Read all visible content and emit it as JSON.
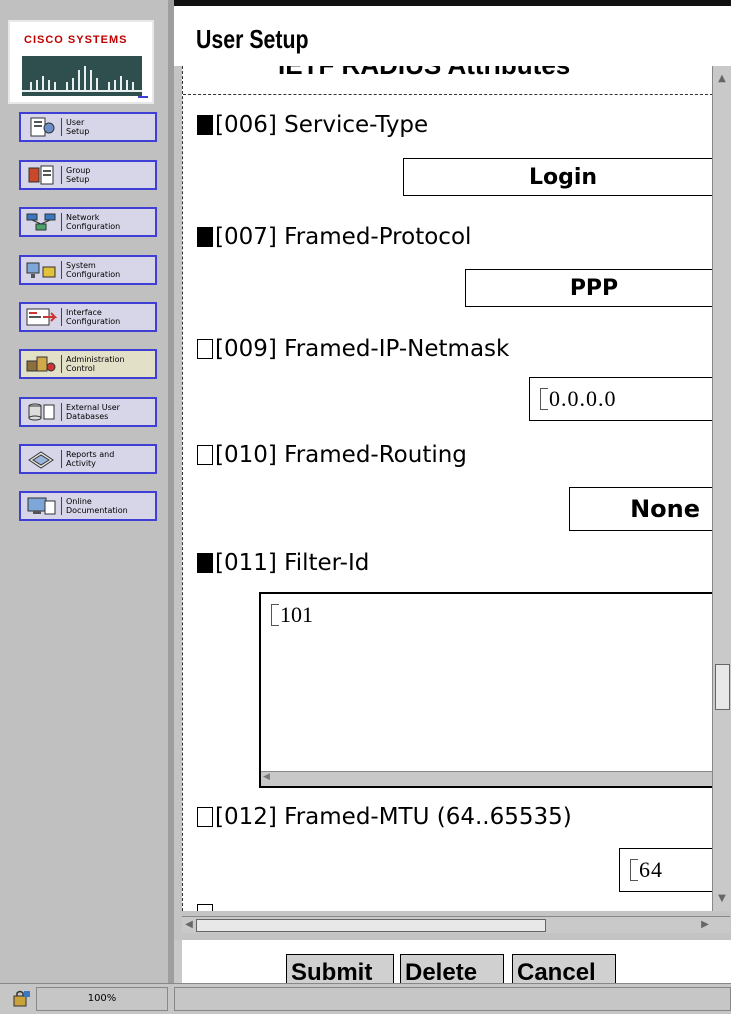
{
  "brand": {
    "logo_text": "Cisco Systems"
  },
  "nav": {
    "items": [
      {
        "label": "User\nSetup",
        "icon": "user-setup-icon"
      },
      {
        "label": "Group\nSetup",
        "icon": "group-setup-icon"
      },
      {
        "label": "Network\nConfiguration",
        "icon": "network-configuration-icon"
      },
      {
        "label": "System\nConfiguration",
        "icon": "system-configuration-icon"
      },
      {
        "label": "Interface\nConfiguration",
        "icon": "interface-configuration-icon"
      },
      {
        "label": "Administration\nControl",
        "icon": "administration-control-icon"
      },
      {
        "label": "External User\nDatabases",
        "icon": "external-user-databases-icon"
      },
      {
        "label": "Reports and\nActivity",
        "icon": "reports-activity-icon"
      },
      {
        "label": "Online\nDocumentation",
        "icon": "online-documentation-icon"
      }
    ]
  },
  "page": {
    "title": "User Setup"
  },
  "section": {
    "heading": "IETF RADIUS Attributes"
  },
  "attributes": {
    "service_type": {
      "label": "[006] Service-Type",
      "checked": true,
      "value": "Login"
    },
    "framed_protocol": {
      "label": "[007] Framed-Protocol",
      "checked": true,
      "value": "PPP"
    },
    "framed_ip_netmask": {
      "label": "[009] Framed-IP-Netmask",
      "checked": false,
      "value": "0.0.0.0"
    },
    "framed_routing": {
      "label": "[010] Framed-Routing",
      "checked": false,
      "value": "None"
    },
    "filter_id": {
      "label": "[011] Filter-Id",
      "checked": true,
      "value": "101"
    },
    "framed_mtu": {
      "label": "[012] Framed-MTU (64..65535)",
      "checked": false,
      "value": "64"
    }
  },
  "actions": {
    "submit": "Submit",
    "delete": "Delete",
    "cancel": "Cancel"
  },
  "status": {
    "zoom": "100%"
  },
  "colors": {
    "nav_border": "#3f3fd6",
    "nav_bg": "#d6d6e8",
    "logo_red": "#c00000"
  }
}
